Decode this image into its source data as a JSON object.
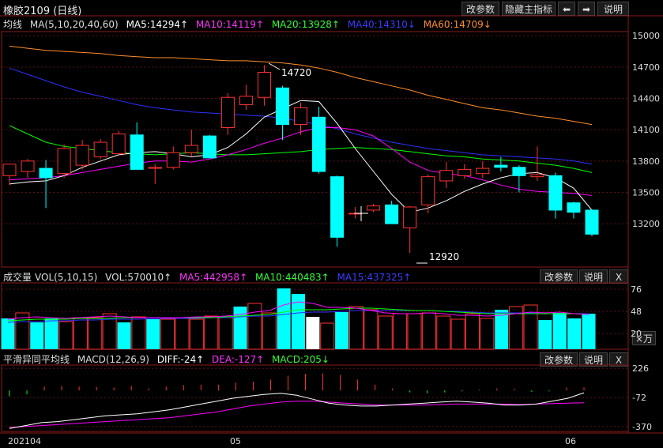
{
  "title": "橡胶2109 (日线)",
  "toolbar": {
    "params": "改参数",
    "hide_indicator": "隐藏主指标",
    "left_arrow": "left-arrow-icon",
    "right_arrow": "right-arrow-icon",
    "help": "说明"
  },
  "main_legend": {
    "name": "均线",
    "params": "MA(5,10,20,40,60)",
    "ma5": "MA5:14294↑",
    "ma10": "MA10:14119↑",
    "ma20": "MA20:13928↑",
    "ma40": "MA40:14310↓",
    "ma60": "MA60:14709↓"
  },
  "vol_panel": {
    "name": "成交量",
    "params": "VOL(5,10,15)",
    "vol": "VOL:570010↑",
    "ma5": "MA5:442958↑",
    "ma10": "MA10:440483↑",
    "ma15": "MA15:437325↑",
    "params_btn": "改参数",
    "help_btn": "说明",
    "close_btn": "X",
    "unit": "×万"
  },
  "macd_panel": {
    "name": "平滑异同平均线",
    "params": "MACD(12,26,9)",
    "diff": "DIFF:-24↑",
    "dea": "DEA:-127↑",
    "macd": "MACD:205↓",
    "params_btn": "改参数",
    "help_btn": "说明",
    "close_btn": "X"
  },
  "annotations": {
    "high": "14720",
    "low": "12920"
  },
  "x_labels": [
    "202104",
    "05",
    "06"
  ],
  "colors": {
    "up": "#ff3232",
    "down": "#00ffff",
    "ma5": "#ffffff",
    "ma10": "#ff00ff",
    "ma20": "#00ff00",
    "ma40": "#2f2fff",
    "ma60": "#ff8c2a",
    "grid": "#8b1a1a"
  },
  "chart_data": [
    {
      "type": "candlestick",
      "ylim": [
        12800,
        15100
      ],
      "yticks": [
        15000,
        14700,
        14400,
        14100,
        13800,
        13500,
        13200
      ],
      "candles": [
        {
          "o": 13660,
          "h": 13740,
          "l": 13570,
          "c": 13770
        },
        {
          "o": 13700,
          "h": 13820,
          "l": 13640,
          "c": 13800
        },
        {
          "o": 13730,
          "h": 13810,
          "l": 13350,
          "c": 13640
        },
        {
          "o": 13680,
          "h": 13960,
          "l": 13640,
          "c": 13920
        },
        {
          "o": 13760,
          "h": 14000,
          "l": 13720,
          "c": 13950
        },
        {
          "o": 13840,
          "h": 14010,
          "l": 13820,
          "c": 13980
        },
        {
          "o": 13870,
          "h": 14090,
          "l": 13850,
          "c": 14060
        },
        {
          "o": 14050,
          "h": 14170,
          "l": 13990,
          "c": 13720
        },
        {
          "o": 13730,
          "h": 13770,
          "l": 13580,
          "c": 13740
        },
        {
          "o": 13740,
          "h": 13940,
          "l": 13720,
          "c": 13880
        },
        {
          "o": 13880,
          "h": 14100,
          "l": 13850,
          "c": 13950
        },
        {
          "o": 14040,
          "h": 14050,
          "l": 13840,
          "c": 13830
        },
        {
          "o": 14120,
          "h": 14450,
          "l": 14050,
          "c": 14410
        },
        {
          "o": 14340,
          "h": 14530,
          "l": 14290,
          "c": 14420
        },
        {
          "o": 14410,
          "h": 14720,
          "l": 14330,
          "c": 14650
        },
        {
          "o": 14500,
          "h": 14520,
          "l": 14000,
          "c": 14150
        },
        {
          "o": 14150,
          "h": 14360,
          "l": 14050,
          "c": 14310
        },
        {
          "o": 14220,
          "h": 14320,
          "l": 13680,
          "c": 13700
        },
        {
          "o": 13650,
          "h": 13660,
          "l": 12980,
          "c": 13070
        },
        {
          "o": 13300,
          "h": 13360,
          "l": 13250,
          "c": 13300
        },
        {
          "o": 13330,
          "h": 13390,
          "l": 13310,
          "c": 13370
        },
        {
          "o": 13380,
          "h": 13420,
          "l": 13200,
          "c": 13200
        },
        {
          "o": 13160,
          "h": 13370,
          "l": 12920,
          "c": 13360
        },
        {
          "o": 13380,
          "h": 13670,
          "l": 13300,
          "c": 13650
        },
        {
          "o": 13610,
          "h": 13790,
          "l": 13540,
          "c": 13710
        },
        {
          "o": 13660,
          "h": 13770,
          "l": 13630,
          "c": 13720
        },
        {
          "o": 13680,
          "h": 13800,
          "l": 13640,
          "c": 13730
        },
        {
          "o": 13760,
          "h": 13840,
          "l": 13700,
          "c": 13740
        },
        {
          "o": 13740,
          "h": 13760,
          "l": 13500,
          "c": 13660
        },
        {
          "o": 13650,
          "h": 13940,
          "l": 13610,
          "c": 13670
        },
        {
          "o": 13660,
          "h": 13690,
          "l": 13250,
          "c": 13330
        },
        {
          "o": 13400,
          "h": 13410,
          "l": 13250,
          "c": 13310
        },
        {
          "o": 13330,
          "h": 13340,
          "l": 13080,
          "c": 13100
        }
      ],
      "ma5": [
        13580,
        13600,
        13610,
        13660,
        13740,
        13800,
        13860,
        13880,
        13890,
        13870,
        13840,
        13860,
        13930,
        14060,
        14220,
        14300,
        14380,
        14370,
        14160,
        13920,
        13700,
        13480,
        13310,
        13350,
        13420,
        13510,
        13580,
        13640,
        13680,
        13690,
        13640,
        13540,
        13330
      ],
      "ma10": [
        13620,
        13630,
        13640,
        13660,
        13690,
        13720,
        13750,
        13780,
        13800,
        13800,
        13790,
        13820,
        13860,
        13910,
        13970,
        14020,
        14080,
        14120,
        14120,
        14100,
        14040,
        13920,
        13790,
        13710,
        13680,
        13660,
        13620,
        13570,
        13530,
        13510,
        13500,
        13490,
        13470
      ],
      "ma20": [
        14140,
        14060,
        13980,
        13940,
        13920,
        13900,
        13880,
        13870,
        13860,
        13870,
        13880,
        13870,
        13860,
        13860,
        13870,
        13880,
        13890,
        13910,
        13920,
        13930,
        13920,
        13910,
        13890,
        13870,
        13850,
        13840,
        13820,
        13810,
        13800,
        13780,
        13760,
        13730,
        13690
      ],
      "ma40": [
        14690,
        14630,
        14570,
        14510,
        14460,
        14420,
        14380,
        14340,
        14310,
        14290,
        14270,
        14260,
        14250,
        14240,
        14230,
        14210,
        14180,
        14150,
        14110,
        14060,
        14020,
        13980,
        13950,
        13920,
        13900,
        13880,
        13860,
        13850,
        13840,
        13830,
        13820,
        13800,
        13770
      ],
      "ma60": [
        14900,
        14880,
        14860,
        14850,
        14840,
        14830,
        14810,
        14800,
        14790,
        14790,
        14780,
        14770,
        14760,
        14760,
        14750,
        14740,
        14720,
        14690,
        14650,
        14600,
        14560,
        14520,
        14480,
        14430,
        14390,
        14350,
        14310,
        14290,
        14260,
        14230,
        14210,
        14180,
        14150
      ]
    },
    {
      "type": "bar",
      "series_name": "VOL",
      "ylim": [
        0,
        84
      ],
      "yticks": [
        76,
        48,
        20
      ],
      "values": [
        39,
        46,
        34,
        39,
        35,
        40,
        40,
        45,
        34,
        41,
        38,
        38,
        40,
        38,
        42,
        40,
        54,
        58,
        46,
        77,
        70,
        41,
        33,
        47,
        54,
        50,
        42,
        45,
        45,
        46,
        42,
        38,
        45,
        39,
        50,
        54,
        56,
        37,
        46,
        39,
        45
      ],
      "colors": [
        "d",
        "u",
        "d",
        "d",
        "u",
        "u",
        "u",
        "u",
        "d",
        "u",
        "d",
        "u",
        "u",
        "u",
        "u",
        "u",
        "d",
        "u",
        "u",
        "d",
        "d",
        "w",
        "u",
        "d",
        "u",
        "u",
        "u",
        "u",
        "u",
        "u",
        "u",
        "u",
        "u",
        "u",
        "d",
        "u",
        "u",
        "d",
        "d",
        "d",
        "d"
      ],
      "ma5": [
        38,
        40,
        41,
        40,
        39,
        40,
        41,
        42,
        41,
        40,
        40,
        40,
        40,
        41,
        41,
        42,
        44,
        47,
        49,
        56,
        60,
        58,
        53,
        53,
        52,
        49,
        46,
        45,
        45,
        46,
        45,
        43,
        43,
        42,
        43,
        45,
        47,
        46,
        47,
        45,
        44
      ],
      "ma10": [
        36,
        37,
        38,
        38,
        38,
        39,
        39,
        39,
        40,
        40,
        40,
        40,
        40,
        40,
        40,
        41,
        42,
        43,
        44,
        47,
        50,
        50,
        50,
        51,
        52,
        52,
        51,
        50,
        49,
        49,
        48,
        47,
        46,
        45,
        45,
        45,
        45,
        45,
        45,
        45,
        44
      ],
      "ma15": [
        34,
        35,
        35,
        36,
        36,
        37,
        37,
        38,
        38,
        38,
        39,
        39,
        39,
        39,
        40,
        40,
        41,
        42,
        42,
        44,
        46,
        47,
        47,
        48,
        49,
        49,
        49,
        49,
        49,
        49,
        48,
        48,
        47,
        46,
        46,
        46,
        46,
        45,
        45,
        45,
        45
      ]
    },
    {
      "type": "macd",
      "ylim": [
        -420,
        260
      ],
      "yticks": [
        226,
        -72,
        -370
      ],
      "histogram": [
        -60,
        -40,
        40,
        45,
        40,
        35,
        30,
        45,
        20,
        40,
        55,
        60,
        60,
        80,
        90,
        110,
        150,
        170,
        175,
        160,
        110,
        60,
        20,
        -20,
        -30,
        -20,
        -10,
        10,
        20,
        15,
        -15,
        -10,
        30,
        30
      ],
      "diff": [
        -390,
        -360,
        -330,
        -320,
        -300,
        -280,
        -260,
        -250,
        -240,
        -220,
        -200,
        -170,
        -140,
        -110,
        -80,
        -60,
        -40,
        -30,
        -50,
        -90,
        -130,
        -150,
        -160,
        -160,
        -150,
        -140,
        -130,
        -120,
        -110,
        -120,
        -130,
        -150,
        -150,
        -140,
        -110,
        -80,
        -24
      ],
      "dea": [
        -380,
        -370,
        -360,
        -350,
        -340,
        -330,
        -320,
        -310,
        -300,
        -290,
        -280,
        -260,
        -240,
        -220,
        -190,
        -160,
        -140,
        -120,
        -110,
        -110,
        -120,
        -130,
        -140,
        -150,
        -150,
        -150,
        -150,
        -145,
        -140,
        -140,
        -140,
        -140,
        -145,
        -140,
        -135,
        -130,
        -127
      ]
    }
  ]
}
